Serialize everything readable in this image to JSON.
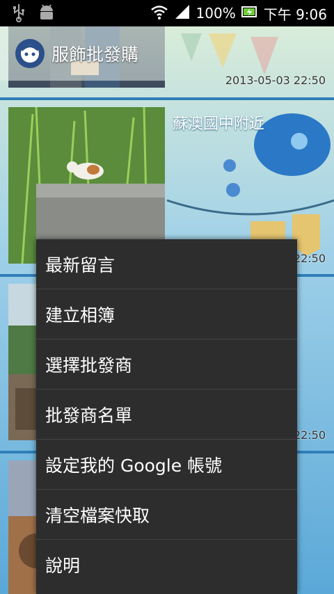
{
  "status_bar": {
    "battery": "100%",
    "time": "下午 9:06"
  },
  "action_bar": {
    "title": "服飾批發購"
  },
  "cards": [
    {
      "title": "",
      "date": "2013-05-03 22:50"
    },
    {
      "title": "蘇澳國中附近",
      "date": "22:50"
    },
    {
      "title": "",
      "date": "22:50"
    },
    {
      "title": "",
      "date": ""
    }
  ],
  "menu": {
    "items": [
      {
        "label": "最新留言"
      },
      {
        "label": "建立相簿"
      },
      {
        "label": "選擇批發商"
      },
      {
        "label": "批發商名單"
      },
      {
        "label": "設定我的 Google 帳號"
      },
      {
        "label": "清空檔案快取"
      },
      {
        "label": "說明"
      }
    ]
  }
}
